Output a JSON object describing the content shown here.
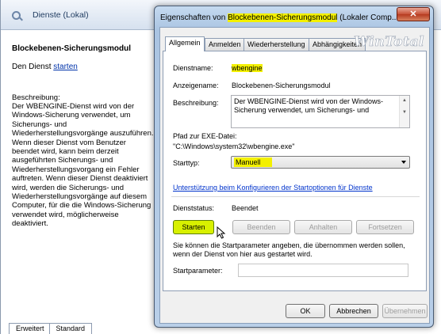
{
  "background": {
    "header_title": "Dienste (Lokal)",
    "service_name": "Blockebenen-Sicherungsmodul",
    "link_prefix": "Den Dienst ",
    "link_label": "starten",
    "desc_title": "Beschreibung:",
    "description": "Der WBENGINE-Dienst wird von der Windows-Sicherung verwendet, um Sicherungs- und Wiederherstellungsvorgänge auszuführen. Wenn dieser Dienst vom Benutzer beendet wird, kann beim derzeit ausgeführten Sicherungs- und Wiederherstellungsvorgang ein Fehler auftreten. Wenn dieser Dienst deaktiviert wird, werden die Sicherungs- und Wiederherstellungsvorgänge auf diesem Computer, für die die Windows-Sicherung verwendet wird, möglicherweise deaktiviert.",
    "tabs": [
      "Erweitert",
      "Standard"
    ]
  },
  "dialog": {
    "title_prefix": "Eigenschaften von ",
    "title_highlight": "Blockebenen-Sicherungsmodul",
    "title_suffix": " (Lokaler Comp...",
    "close_label": "✕",
    "tabs": [
      "Allgemein",
      "Anmelden",
      "Wiederherstellung",
      "Abhängigkeiten"
    ],
    "watermark": "WinTotal",
    "fields": {
      "dienstname_label": "Dienstname:",
      "dienstname_value": "wbengine",
      "anzeigename_label": "Anzeigename:",
      "anzeigename_value": "Blockebenen-Sicherungsmodul",
      "beschreibung_label": "Beschreibung:",
      "beschreibung_value": "Der WBENGINE-Dienst wird von der Windows-Sicherung verwendet, um Sicherungs- und",
      "exe_label": "Pfad zur EXE-Datei:",
      "exe_value": "\"C:\\Windows\\system32\\wbengine.exe\"",
      "starttyp_label": "Starttyp:",
      "starttyp_value": "Manuell",
      "help_link": "Unterstützung beim Konfigurieren der Startoptionen für Dienste",
      "status_label": "Dienststatus:",
      "status_value": "Beendet"
    },
    "buttons": {
      "start": "Starten",
      "stop": "Beenden",
      "pause": "Anhalten",
      "resume": "Fortsetzen"
    },
    "hint": "Sie können die Startparameter angeben, die übernommen werden sollen, wenn der Dienst von hier aus gestartet wird.",
    "param_label": "Startparameter:",
    "param_value": "",
    "footer": {
      "ok": "OK",
      "cancel": "Abbrechen",
      "apply": "Übernehmen"
    },
    "highlight_color": "#f3f000"
  }
}
